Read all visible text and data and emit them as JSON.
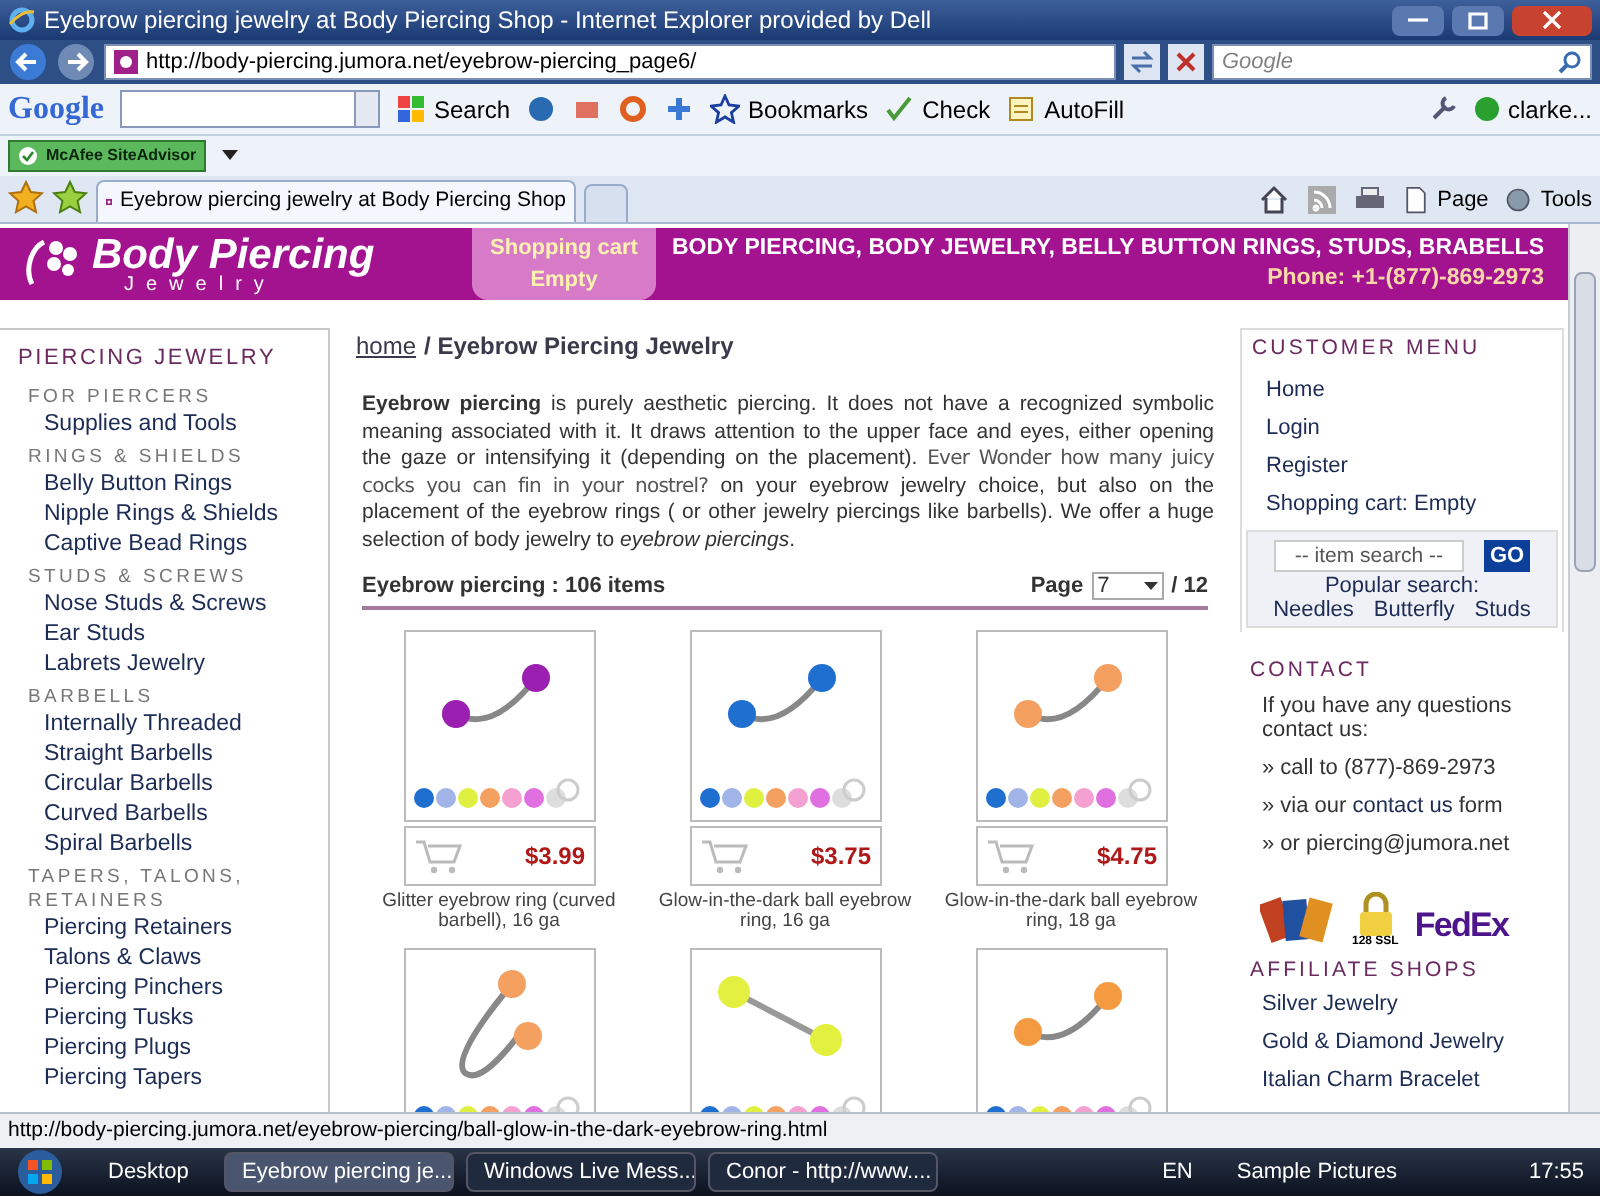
{
  "window": {
    "title": "Eyebrow piercing jewelry at Body Piercing Shop - Internet Explorer provided by Dell"
  },
  "address_bar": {
    "url": "http://body-piercing.jumora.net/eyebrow-piercing_page6/",
    "search_placeholder": "Google"
  },
  "google_toolbar": {
    "logo": "Google",
    "buttons": [
      "Search",
      "Bookmarks",
      "Check",
      "AutoFill"
    ],
    "user": "clarke..."
  },
  "siteadvisor": {
    "label": "McAfee SiteAdvisor"
  },
  "tabs": [
    {
      "label": "Eyebrow piercing jewelry at Body Piercing Shop",
      "selected": true
    }
  ],
  "command_bar": [
    "Page",
    "Tools"
  ],
  "site_header": {
    "logo_title": "Body Piercing",
    "logo_subtitle": "Jewelry",
    "cart_title": "Shopping cart",
    "cart_status": "Empty",
    "tagline": "BODY PIERCING, BODY JEWELRY, BELLY BUTTON RINGS, STUDS, BRABELLS",
    "phone": "Phone: +1-(877)-869-2973"
  },
  "sidebar": {
    "title": "PIERCING JEWELRY",
    "groups": [
      {
        "heading": "FOR PIERCERS",
        "items": [
          "Supplies and Tools"
        ]
      },
      {
        "heading": "RINGS & SHIELDS",
        "items": [
          "Belly Button Rings",
          "Nipple Rings & Shields",
          "Captive Bead Rings"
        ]
      },
      {
        "heading": "STUDS & SCREWS",
        "items": [
          "Nose Studs & Screws",
          "Ear Studs",
          "Labrets Jewelry"
        ]
      },
      {
        "heading": "BARBELLS",
        "items": [
          "Internally Threaded",
          "Straight Barbells",
          "Circular Barbells",
          "Curved Barbells",
          "Spiral Barbells"
        ]
      },
      {
        "heading": "TAPERS, TALONS, RETAINERS",
        "items": [
          "Piercing Retainers",
          "Talons & Claws",
          "Piercing Pinchers",
          "Piercing Tusks",
          "Piercing Plugs",
          "Piercing Tapers"
        ]
      }
    ]
  },
  "breadcrumb": {
    "link": "home",
    "current": "/ Eyebrow Piercing Jewelry"
  },
  "intro": [
    {
      "kind": "text",
      "text": "**Eyebrow piercing** is purely aesthetic piercing. It does not have a recognized symbolic meaning associated with it. It draws attention to the upper face and eyes, either opening the gaze or intensifying it (depending on the placement)."
    },
    {
      "kind": "inserted",
      "text": "Ever Wonder how many juicy cocks you can fin in your nostrel?"
    },
    {
      "kind": "text",
      "text": "on your eyebrow jewelry choice, but also on the placement of the eyebrow rings ( or other jewelry piercings like barbells). We offer a huge selection of body jewelry to *eyebrow piercings*."
    }
  ],
  "listing": {
    "title": "Eyebrow piercing : 106 items",
    "page_label": "Page",
    "page_value": "7",
    "page_total": "/ 12"
  },
  "products": [
    {
      "kind": "curved",
      "color": "#9b1fb0",
      "name": "Glitter eyebrow ring (curved barbell), 16 ga",
      "price": "$3.99"
    },
    {
      "kind": "curved",
      "color": "#1e6fd0",
      "name": "Glow-in-the-dark ball eyebrow ring, 16 ga",
      "price": "$3.75"
    },
    {
      "kind": "curved",
      "color": "#f4a060",
      "name": "Glow-in-the-dark ball eyebrow ring, 18 ga",
      "price": "$4.75"
    },
    {
      "kind": "spiral",
      "color": "#f4a060"
    },
    {
      "kind": "straight",
      "color": "#e4f040"
    },
    {
      "kind": "curved",
      "color": "#f49a40"
    }
  ],
  "customer_menu": {
    "title": "CUSTOMER MENU",
    "items": [
      "Home",
      "Login",
      "Register",
      "Shopping cart: Empty"
    ]
  },
  "item_search": {
    "placeholder": "-- item search --",
    "button": "GO",
    "popular_label": "Popular search:",
    "popular": [
      "Needles",
      "Butterfly",
      "Studs"
    ]
  },
  "contact": {
    "title": "CONTACT",
    "text": "If you have any questions contact us:",
    "lines": [
      {
        "parts": [
          {
            "text": "» call to (877)-869-2973",
            "link": false
          }
        ]
      },
      {
        "parts": [
          {
            "text": "» via our",
            "link": false
          },
          {
            "text": "contact us",
            "link": true
          },
          {
            "text": "form",
            "link": false
          }
        ]
      },
      {
        "parts": [
          {
            "text": "» or piercing@jumora.net",
            "link": false
          }
        ]
      }
    ]
  },
  "badges": {
    "ssl": "128 SSL",
    "shipper": "FedEx"
  },
  "affiliate": {
    "title": "AFFILIATE SHOPS",
    "items": [
      "Silver Jewelry",
      "Gold & Diamond Jewelry",
      "Italian Charm Bracelet"
    ]
  },
  "status_bar": {
    "url": "http://body-piercing.jumora.net/eyebrow-piercing/ball-glow-in-the-dark-eyebrow-ring.html"
  },
  "taskbar": {
    "toolbar": "Desktop",
    "items": [
      {
        "label": "Eyebrow piercing je...",
        "selected": true
      },
      {
        "label": "Windows Live Mess...",
        "selected": false
      },
      {
        "label": "Conor - http://www....",
        "selected": false
      }
    ],
    "language": "EN",
    "tray_toolbar": "Sample Pictures",
    "time": "17:55"
  }
}
